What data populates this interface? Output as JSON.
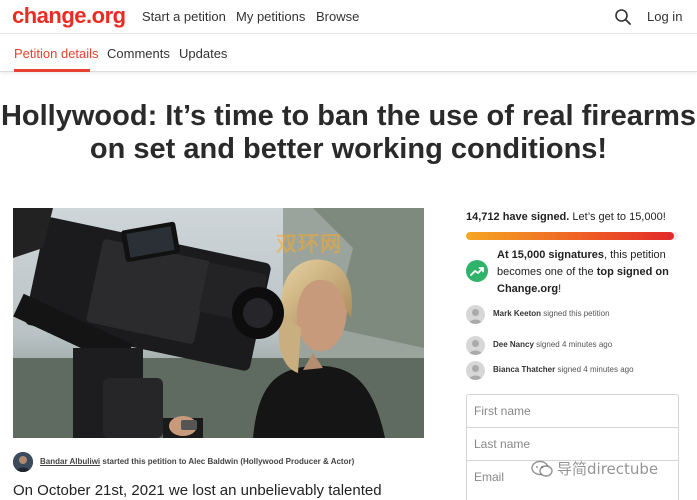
{
  "header": {
    "logo": "change.org",
    "nav": [
      "Start a petition",
      "My petitions",
      "Browse"
    ],
    "login": "Log in"
  },
  "tabs": [
    "Petition details",
    "Comments",
    "Updates"
  ],
  "petition": {
    "title_line1": "Hollywood: It’s time to ban the use of real firearms",
    "title_line2": "on set and better working conditions!",
    "starter_name": "Bandar Albuliwi",
    "starter_rest": "started this petition to Alec Baldwin (Hollywood Producer & Actor)",
    "story_start": "On October 21st, 2021 we lost an unbelievably talented"
  },
  "sidebar": {
    "signed_count": "14,712 have signed.",
    "signed_goal": "Let’s get to 15,000!",
    "progress_fraction": 0.98,
    "milestone": {
      "part1": "At 15,000 signatures",
      "part2": ", this petition becomes one of the ",
      "part3": "top signed on Change.org",
      "part4": "!"
    },
    "signers": [
      {
        "name": "Mark Keeton",
        "action": "signed this petition"
      },
      {
        "name": "Dee Nancy",
        "action": "signed 4 minutes ago"
      },
      {
        "name": "Bianca Thatcher",
        "action": "signed 4 minutes ago"
      }
    ]
  },
  "form": {
    "first_name_placeholder": "First name",
    "last_name_placeholder": "Last name",
    "email_placeholder": "Email"
  },
  "watermarks": {
    "top": "双环网",
    "bottom": "导简directube"
  },
  "colors": {
    "brand": "#ec2c22",
    "active_tab": "#e8412f",
    "milestone_green": "#2fb36b"
  }
}
